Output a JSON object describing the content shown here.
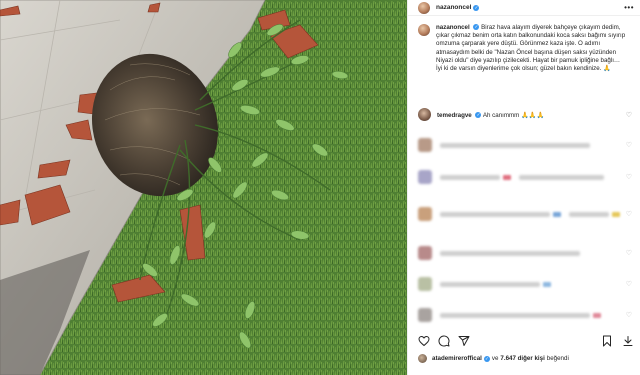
{
  "post": {
    "username": "nazanoncel",
    "caption": "Biraz hava alayım diyerek bahçeye çıkayım dedim, çıkar çıkmaz benim orta katın balkonundaki koca saksı bağımı sıyırıp omzuma çarparak yere düştü. Görünmez kaza işte. O adımı atmasaydım belki de \"Nazan Öncel başına düşen saksı yüzünden Niyazi oldu\" diye yazılıp çizilecekti. Hayat bir pamuk ipliğine bağlı…",
    "caption_line2": "İyi ki de varsın diyenlerime çok olsun; güzel bakın kendinize. 🙏"
  },
  "comment": {
    "username": "temedragve",
    "text": "Ah canımmm 🙏🙏🙏"
  },
  "likes": {
    "liker": "atademireroffical",
    "text_ve": "ve",
    "count_text": "7.647 diğer kişi",
    "text_suffix": "beğendi"
  },
  "icons": {
    "more": "more-horizontal-icon",
    "heart": "heart-icon",
    "comment": "comment-icon",
    "share": "share-icon",
    "bookmark": "bookmark-icon",
    "download": "download-icon",
    "verified": "verified-badge-icon"
  },
  "colors": {
    "verified": "#3897f0",
    "text": "#262626",
    "muted": "#8e8e8e"
  }
}
